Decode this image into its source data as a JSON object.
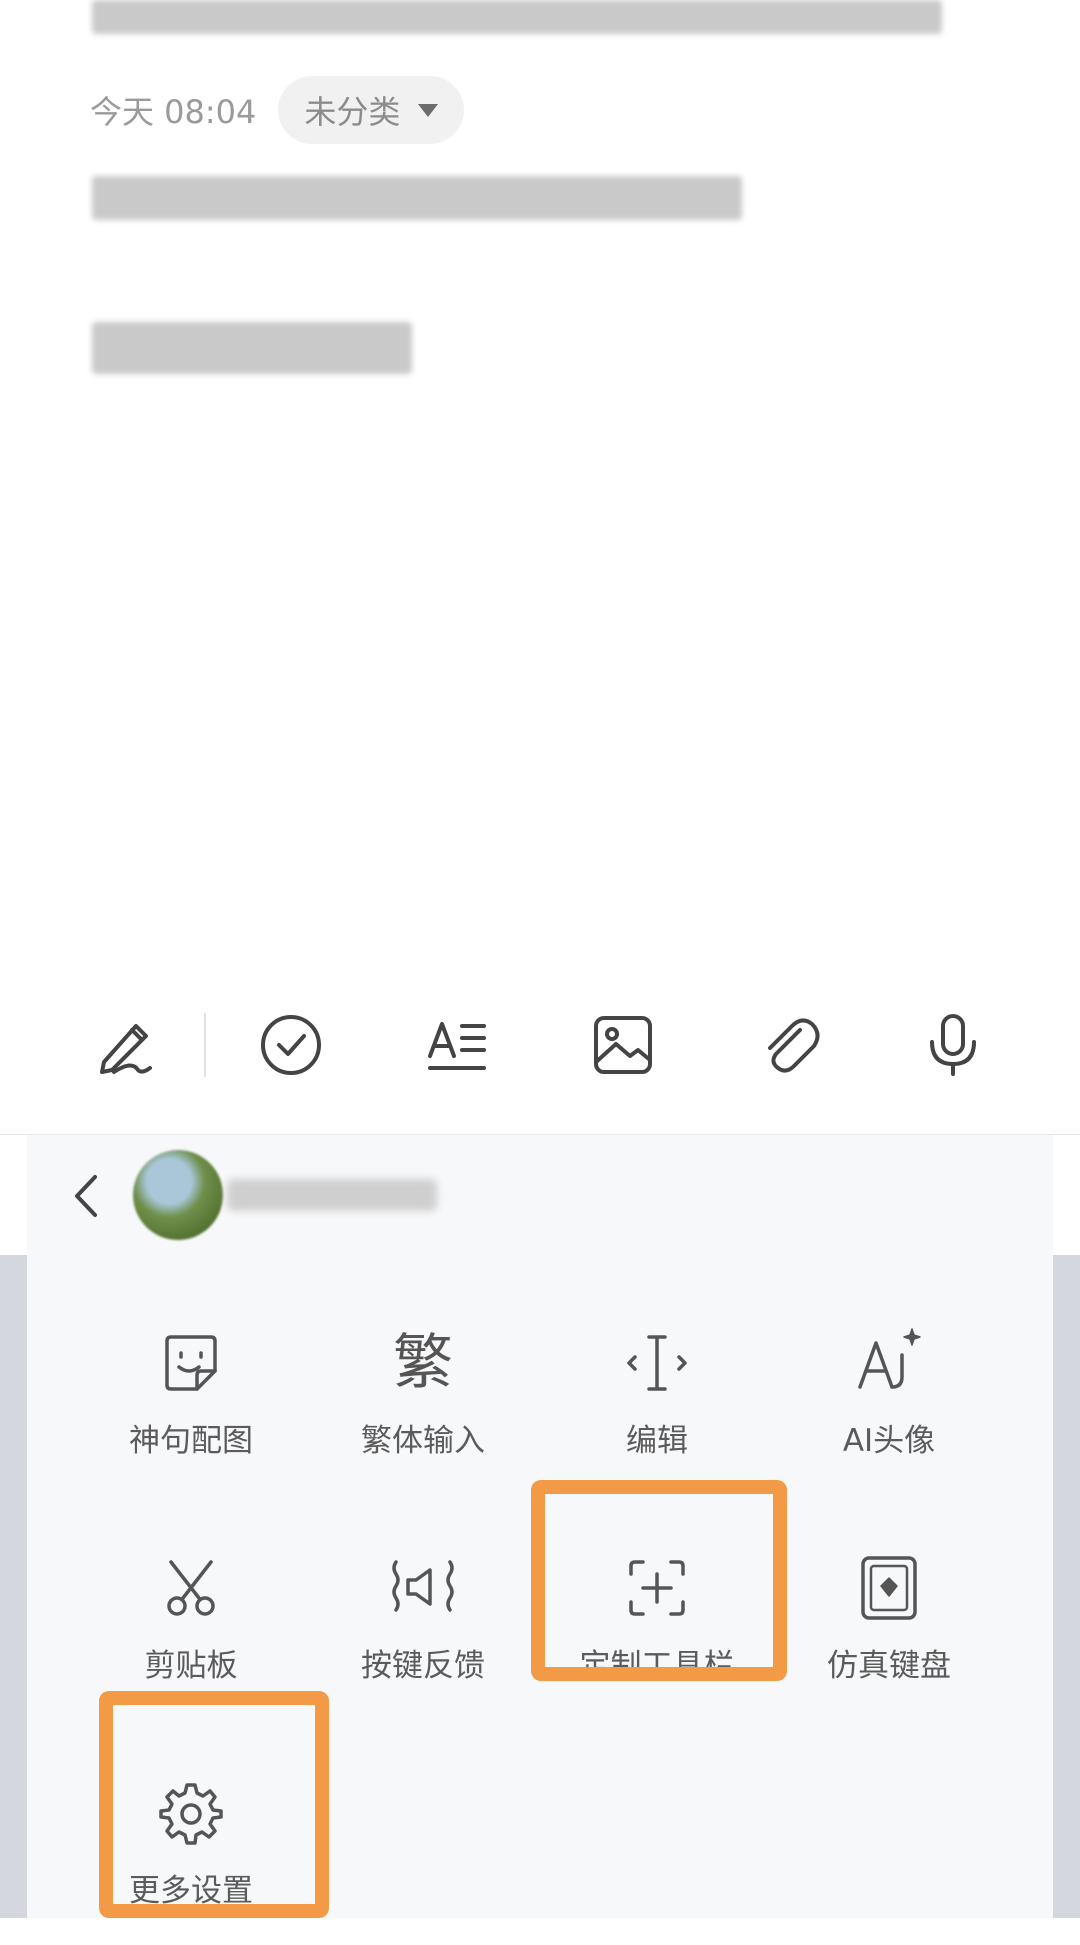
{
  "note": {
    "date": "今天 08:04",
    "category_label": "未分类"
  },
  "colors": {
    "accent_highlight": "#f29a45",
    "icon_color": "#444444",
    "panel_background": "#f7f8fa"
  },
  "toolbar": {
    "icons": [
      "handwriting-pen-icon",
      "checklist-icon",
      "text-format-icon",
      "image-icon",
      "attachment-icon",
      "microphone-icon"
    ]
  },
  "panel": {
    "items": [
      {
        "label": "神句配图",
        "icon": "sticker-face-icon"
      },
      {
        "label": "繁体输入",
        "icon": "traditional-char-icon",
        "glyph": "繁"
      },
      {
        "label": "编辑",
        "icon": "text-cursor-icon"
      },
      {
        "label": "AI头像",
        "icon": "ai-avatar-icon"
      },
      {
        "label": "剪贴板",
        "icon": "scissors-icon"
      },
      {
        "label": "按键反馈",
        "icon": "key-feedback-icon"
      },
      {
        "label": "定制工具栏",
        "icon": "customize-toolbar-icon"
      },
      {
        "label": "仿真键盘",
        "icon": "simulated-keyboard-icon"
      },
      {
        "label": "更多设置",
        "icon": "gear-icon"
      }
    ]
  }
}
